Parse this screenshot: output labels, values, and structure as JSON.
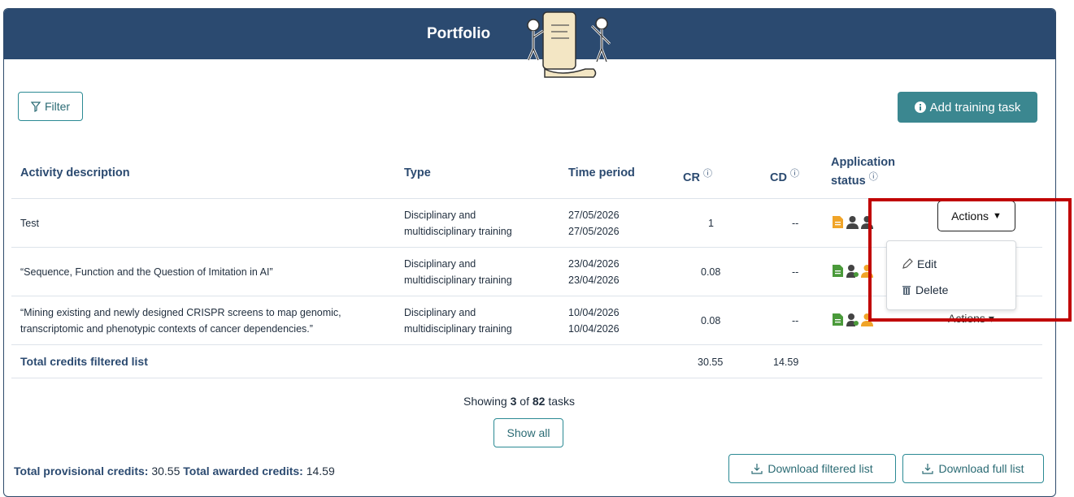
{
  "header": {
    "title": "Portfolio"
  },
  "toolbar": {
    "filter_label": "Filter",
    "add_label": "Add training task"
  },
  "table": {
    "columns": [
      "Activity description",
      "Type",
      "Time period",
      "CR",
      "CD",
      "Application",
      "status"
    ],
    "rows": [
      {
        "description": [
          "Test"
        ],
        "type": [
          "Disciplinary and",
          "multidisciplinary training"
        ],
        "period": [
          "27/05/2026",
          "27/05/2026"
        ],
        "cr": "1",
        "cd": "--"
      },
      {
        "description": [
          "“Sequence, Function and the Question of Imitation in AI”"
        ],
        "type": [
          "Disciplinary and",
          "multidisciplinary training"
        ],
        "period": [
          "23/04/2026",
          "23/04/2026"
        ],
        "cr": "0.08",
        "cd": "--"
      },
      {
        "description": [
          "“Mining existing and newly designed CRISPR screens to map genomic,",
          "transcriptomic and phenotypic contexts of cancer dependencies.”"
        ],
        "type": [
          "Disciplinary and",
          "multidisciplinary training"
        ],
        "period": [
          "10/04/2026",
          "10/04/2026"
        ],
        "cr": "0.08",
        "cd": "--"
      }
    ],
    "total_label": "Total credits filtered list",
    "total_cr": "30.55",
    "total_cd": "14.59"
  },
  "actions": {
    "label": "Actions",
    "menu": [
      "Edit",
      "Delete"
    ]
  },
  "pagination": {
    "showing": "Showing",
    "count": "3",
    "of": "of",
    "total": "82",
    "suffix": "tasks",
    "show_all": "Show all"
  },
  "footer": {
    "provisional_label": "Total provisional credits:",
    "provisional_value": "30.55",
    "awarded_label": "Total awarded credits:",
    "awarded_value": "14.59",
    "download_filtered": "Download filtered list",
    "download_full": "Download full list"
  },
  "colors": {
    "header": "#2b4a70",
    "accent": "#3b8790",
    "doc_orange": "#f0a428",
    "doc_green": "#4a9a3a",
    "highlight": "#c00000"
  }
}
